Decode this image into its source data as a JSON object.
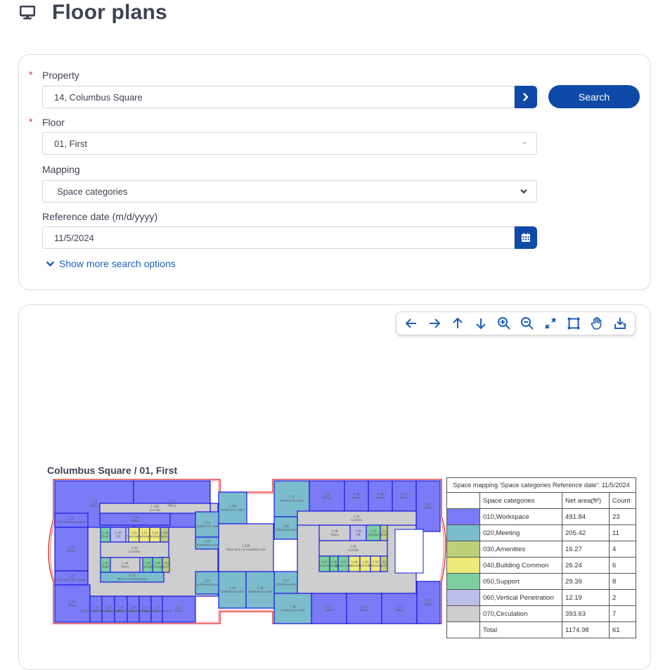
{
  "header": {
    "title": "Floor plans",
    "icon": "monitor-icon"
  },
  "search": {
    "property": {
      "label": "Property",
      "required": true,
      "value": "14, Columbus Square"
    },
    "floor": {
      "label": "Floor",
      "required": true,
      "value": "01, First"
    },
    "mapping": {
      "label": "Mapping",
      "value": "Space categories"
    },
    "reference_date": {
      "label": "Reference date (m/d/yyyy)",
      "value": "11/5/2024"
    },
    "search_button": "Search",
    "more_options": "Show more search options",
    "required_marker": "*"
  },
  "toolbar": {
    "buttons": [
      {
        "name": "pan-left",
        "icon": "arrow-left-icon"
      },
      {
        "name": "pan-right",
        "icon": "arrow-right-icon"
      },
      {
        "name": "pan-up",
        "icon": "arrow-up-icon"
      },
      {
        "name": "pan-down",
        "icon": "arrow-down-icon"
      },
      {
        "name": "zoom-in",
        "icon": "zoom-in-icon"
      },
      {
        "name": "zoom-out",
        "icon": "zoom-out-icon"
      },
      {
        "name": "fit",
        "icon": "expand-icon"
      },
      {
        "name": "select-area",
        "icon": "select-area-icon"
      },
      {
        "name": "pan",
        "icon": "hand-icon"
      },
      {
        "name": "download",
        "icon": "download-icon"
      }
    ]
  },
  "plan": {
    "title": "Columbus Square / 01, First",
    "rooms": [
      {
        "id": "1.32",
        "name": "Office",
        "cat": "010"
      },
      {
        "id": "1.33",
        "name": "Office",
        "cat": "010"
      },
      {
        "id": "1.43D",
        "name": "Corridor",
        "cat": "070"
      },
      {
        "id": "1.44",
        "name": "Office",
        "cat": "010"
      },
      {
        "id": "1.31",
        "name": "Concentration rooms",
        "cat": "010"
      },
      {
        "id": "1.30",
        "name": "Library",
        "cat": "010"
      },
      {
        "id": "1.48",
        "name": "Shaft",
        "cat": "050"
      },
      {
        "id": "1.49",
        "name": "Lift",
        "cat": "060"
      },
      {
        "id": "1.50",
        "name": "Restroom",
        "cat": "040"
      },
      {
        "id": "1.51",
        "name": "Restroom",
        "cat": "040"
      },
      {
        "id": "1.52",
        "name": "Restroom",
        "cat": "040"
      },
      {
        "id": "1.43A",
        "name": "Pantry",
        "cat": "030"
      },
      {
        "id": "1.43",
        "name": "Corridor",
        "cat": "070"
      },
      {
        "id": "1.47",
        "name": "Shaft",
        "cat": "050"
      },
      {
        "id": "1.46",
        "name": "Stairs",
        "cat": "070"
      },
      {
        "id": "1.45",
        "name": "Storage",
        "cat": "050"
      },
      {
        "id": "1.44",
        "name": "Storage",
        "cat": "050"
      },
      {
        "id": "1.43B",
        "name": "Pantry",
        "cat": "030"
      },
      {
        "id": "1.53",
        "name": "Work & meeting area",
        "cat": "020"
      },
      {
        "id": "1.29",
        "name": "Concentration rooms",
        "cat": "010"
      },
      {
        "id": "1.28",
        "name": "Office",
        "cat": "010"
      },
      {
        "id": "1.27",
        "name": "Concentration rooms",
        "cat": "010"
      },
      {
        "id": "1.26",
        "name": "Concentration rooms",
        "cat": "010"
      },
      {
        "id": "1.25",
        "name": "Concentration rooms",
        "cat": "010"
      },
      {
        "id": "1.24",
        "name": "Concentration rooms",
        "cat": "010"
      },
      {
        "id": "1.23",
        "name": "Concentration rooms",
        "cat": "010"
      },
      {
        "id": "1.22",
        "name": "Concentration rooms",
        "cat": "010"
      },
      {
        "id": "1.21",
        "name": "Office",
        "cat": "010"
      },
      {
        "id": "1.25A",
        "name": "Conference room",
        "cat": "020"
      },
      {
        "id": "1.34",
        "name": "Conference room",
        "cat": "020"
      },
      {
        "id": "1.35",
        "name": "Conference room",
        "cat": "020"
      },
      {
        "id": "1.43E",
        "name": "Open plan consultation area",
        "cat": "070"
      },
      {
        "id": "1.20",
        "name": "Conference room",
        "cat": "020"
      },
      {
        "id": "1.19",
        "name": "Conference room",
        "cat": "020"
      },
      {
        "id": "1.18",
        "name": "Conference room",
        "cat": "020"
      },
      {
        "id": "1.37",
        "name": "Conference room",
        "cat": "020"
      },
      {
        "id": "1.36",
        "name": "Conference room",
        "cat": "020"
      },
      {
        "id": "1.38",
        "name": "Office",
        "cat": "010"
      },
      {
        "id": "1.39",
        "name": "Office",
        "cat": "010"
      },
      {
        "id": "1.40",
        "name": "Office",
        "cat": "010"
      },
      {
        "id": "1.41",
        "name": "Office",
        "cat": "010"
      },
      {
        "id": "1.42",
        "name": "Office",
        "cat": "010"
      },
      {
        "id": "1.11",
        "name": "Corridor",
        "cat": "070"
      },
      {
        "id": "1.08",
        "name": "Stairs",
        "cat": "070"
      },
      {
        "id": "1.09",
        "name": "Lift",
        "cat": "060"
      },
      {
        "id": "1.10",
        "name": "Storage",
        "cat": "050"
      },
      {
        "id": "1.11A",
        "name": "Pantry",
        "cat": "030"
      },
      {
        "id": "1.01",
        "name": "Corridor",
        "cat": "070"
      },
      {
        "id": "1.07",
        "name": "Technical",
        "cat": "050"
      },
      {
        "id": "1.06",
        "name": "Storage",
        "cat": "050"
      },
      {
        "id": "1.05",
        "name": "Janitor room",
        "cat": "050"
      },
      {
        "id": "1.04",
        "name": "Restroom",
        "cat": "040"
      },
      {
        "id": "1.03",
        "name": "Restroom",
        "cat": "040"
      },
      {
        "id": "1.02",
        "name": "Restroom",
        "cat": "040"
      },
      {
        "id": "1.11B",
        "name": "Pantry",
        "cat": "030"
      },
      {
        "id": "1.17",
        "name": "Conference room",
        "cat": "020"
      },
      {
        "id": "1.16",
        "name": "Conference room",
        "cat": "020"
      },
      {
        "id": "1.15",
        "name": "Office",
        "cat": "010"
      },
      {
        "id": "1.14",
        "name": "Office",
        "cat": "010"
      },
      {
        "id": "1.13",
        "name": "Office",
        "cat": "010"
      },
      {
        "id": "1.12",
        "name": "Office",
        "cat": "010"
      }
    ]
  },
  "legend": {
    "caption": "Space mapping 'Space categories Reference date': 11/5/2024",
    "headers": {
      "category": "Space categories",
      "area": "Net area(ft²)",
      "count": "Count"
    },
    "rows": [
      {
        "code": "010",
        "category": "010,Workspace",
        "area": "491.84",
        "count": "23",
        "color": "#7b7bf7"
      },
      {
        "code": "020",
        "category": "020,Meeting",
        "area": "205.42",
        "count": "11",
        "color": "#7bbccd"
      },
      {
        "code": "030",
        "category": "030,Amenities",
        "area": "16.27",
        "count": "4",
        "color": "#bdd07b"
      },
      {
        "code": "040",
        "category": "040,Building Common",
        "area": "26.24",
        "count": "6",
        "color": "#eeeb7b"
      },
      {
        "code": "050",
        "category": "050,Support",
        "area": "29.39",
        "count": "8",
        "color": "#7bcfa0"
      },
      {
        "code": "060",
        "category": "060,Vertical Penetration",
        "area": "12.19",
        "count": "2",
        "color": "#bdbdeb"
      },
      {
        "code": "070",
        "category": "070,Circulation",
        "area": "393.63",
        "count": "7",
        "color": "#cecece"
      }
    ],
    "total": {
      "label": "Total",
      "area": "1174.98",
      "count": "61"
    }
  },
  "colors": {
    "primary": "#0f4aa8",
    "link": "#1f5fb8",
    "required": "#c0392b",
    "outline": "#e02020",
    "room_border": "#1a1ae0"
  }
}
